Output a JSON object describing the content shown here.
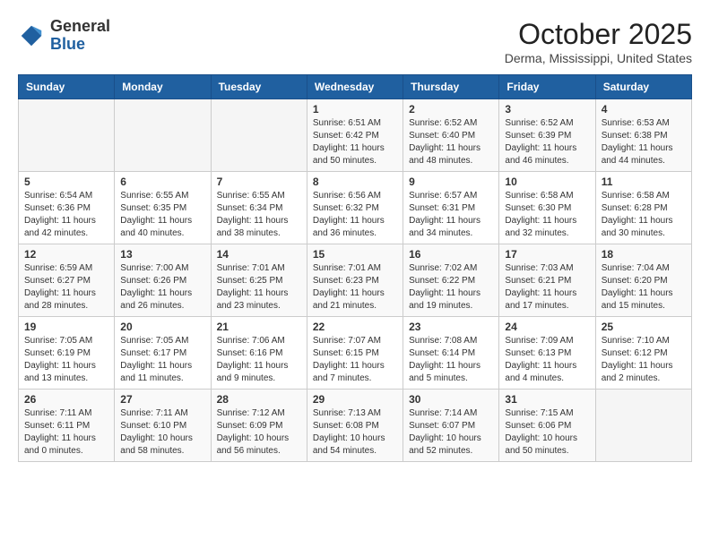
{
  "header": {
    "logo": {
      "general": "General",
      "blue": "Blue"
    },
    "title": "October 2025",
    "location": "Derma, Mississippi, United States"
  },
  "weekdays": [
    "Sunday",
    "Monday",
    "Tuesday",
    "Wednesday",
    "Thursday",
    "Friday",
    "Saturday"
  ],
  "weeks": [
    [
      {
        "day": "",
        "info": ""
      },
      {
        "day": "",
        "info": ""
      },
      {
        "day": "",
        "info": ""
      },
      {
        "day": "1",
        "info": "Sunrise: 6:51 AM\nSunset: 6:42 PM\nDaylight: 11 hours\nand 50 minutes."
      },
      {
        "day": "2",
        "info": "Sunrise: 6:52 AM\nSunset: 6:40 PM\nDaylight: 11 hours\nand 48 minutes."
      },
      {
        "day": "3",
        "info": "Sunrise: 6:52 AM\nSunset: 6:39 PM\nDaylight: 11 hours\nand 46 minutes."
      },
      {
        "day": "4",
        "info": "Sunrise: 6:53 AM\nSunset: 6:38 PM\nDaylight: 11 hours\nand 44 minutes."
      }
    ],
    [
      {
        "day": "5",
        "info": "Sunrise: 6:54 AM\nSunset: 6:36 PM\nDaylight: 11 hours\nand 42 minutes."
      },
      {
        "day": "6",
        "info": "Sunrise: 6:55 AM\nSunset: 6:35 PM\nDaylight: 11 hours\nand 40 minutes."
      },
      {
        "day": "7",
        "info": "Sunrise: 6:55 AM\nSunset: 6:34 PM\nDaylight: 11 hours\nand 38 minutes."
      },
      {
        "day": "8",
        "info": "Sunrise: 6:56 AM\nSunset: 6:32 PM\nDaylight: 11 hours\nand 36 minutes."
      },
      {
        "day": "9",
        "info": "Sunrise: 6:57 AM\nSunset: 6:31 PM\nDaylight: 11 hours\nand 34 minutes."
      },
      {
        "day": "10",
        "info": "Sunrise: 6:58 AM\nSunset: 6:30 PM\nDaylight: 11 hours\nand 32 minutes."
      },
      {
        "day": "11",
        "info": "Sunrise: 6:58 AM\nSunset: 6:28 PM\nDaylight: 11 hours\nand 30 minutes."
      }
    ],
    [
      {
        "day": "12",
        "info": "Sunrise: 6:59 AM\nSunset: 6:27 PM\nDaylight: 11 hours\nand 28 minutes."
      },
      {
        "day": "13",
        "info": "Sunrise: 7:00 AM\nSunset: 6:26 PM\nDaylight: 11 hours\nand 26 minutes."
      },
      {
        "day": "14",
        "info": "Sunrise: 7:01 AM\nSunset: 6:25 PM\nDaylight: 11 hours\nand 23 minutes."
      },
      {
        "day": "15",
        "info": "Sunrise: 7:01 AM\nSunset: 6:23 PM\nDaylight: 11 hours\nand 21 minutes."
      },
      {
        "day": "16",
        "info": "Sunrise: 7:02 AM\nSunset: 6:22 PM\nDaylight: 11 hours\nand 19 minutes."
      },
      {
        "day": "17",
        "info": "Sunrise: 7:03 AM\nSunset: 6:21 PM\nDaylight: 11 hours\nand 17 minutes."
      },
      {
        "day": "18",
        "info": "Sunrise: 7:04 AM\nSunset: 6:20 PM\nDaylight: 11 hours\nand 15 minutes."
      }
    ],
    [
      {
        "day": "19",
        "info": "Sunrise: 7:05 AM\nSunset: 6:19 PM\nDaylight: 11 hours\nand 13 minutes."
      },
      {
        "day": "20",
        "info": "Sunrise: 7:05 AM\nSunset: 6:17 PM\nDaylight: 11 hours\nand 11 minutes."
      },
      {
        "day": "21",
        "info": "Sunrise: 7:06 AM\nSunset: 6:16 PM\nDaylight: 11 hours\nand 9 minutes."
      },
      {
        "day": "22",
        "info": "Sunrise: 7:07 AM\nSunset: 6:15 PM\nDaylight: 11 hours\nand 7 minutes."
      },
      {
        "day": "23",
        "info": "Sunrise: 7:08 AM\nSunset: 6:14 PM\nDaylight: 11 hours\nand 5 minutes."
      },
      {
        "day": "24",
        "info": "Sunrise: 7:09 AM\nSunset: 6:13 PM\nDaylight: 11 hours\nand 4 minutes."
      },
      {
        "day": "25",
        "info": "Sunrise: 7:10 AM\nSunset: 6:12 PM\nDaylight: 11 hours\nand 2 minutes."
      }
    ],
    [
      {
        "day": "26",
        "info": "Sunrise: 7:11 AM\nSunset: 6:11 PM\nDaylight: 11 hours\nand 0 minutes."
      },
      {
        "day": "27",
        "info": "Sunrise: 7:11 AM\nSunset: 6:10 PM\nDaylight: 10 hours\nand 58 minutes."
      },
      {
        "day": "28",
        "info": "Sunrise: 7:12 AM\nSunset: 6:09 PM\nDaylight: 10 hours\nand 56 minutes."
      },
      {
        "day": "29",
        "info": "Sunrise: 7:13 AM\nSunset: 6:08 PM\nDaylight: 10 hours\nand 54 minutes."
      },
      {
        "day": "30",
        "info": "Sunrise: 7:14 AM\nSunset: 6:07 PM\nDaylight: 10 hours\nand 52 minutes."
      },
      {
        "day": "31",
        "info": "Sunrise: 7:15 AM\nSunset: 6:06 PM\nDaylight: 10 hours\nand 50 minutes."
      },
      {
        "day": "",
        "info": ""
      }
    ]
  ]
}
